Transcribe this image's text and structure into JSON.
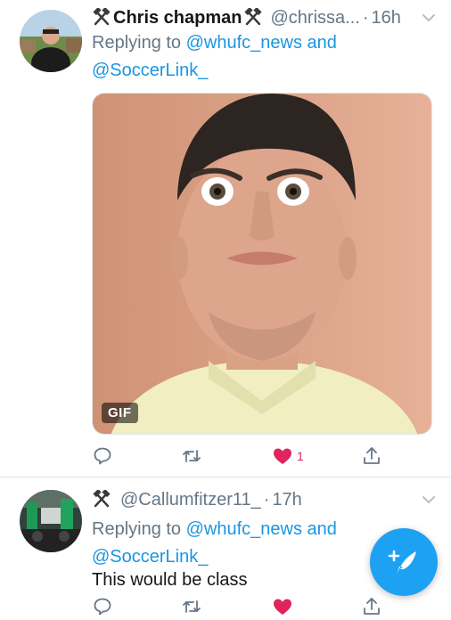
{
  "tweets": [
    {
      "name": "Chris chapman",
      "handle": "@chrissa...",
      "dot": "·",
      "time": "16h",
      "reply_prefix": "Replying to ",
      "reply_line1": "@whufc_news and",
      "reply_line2": "@SoccerLink_",
      "media_badge": "GIF",
      "like_count": "1"
    },
    {
      "handle": "@Callumfitzer11_",
      "dot": "·",
      "time": "17h",
      "reply_prefix": "Replying to ",
      "reply_line1": "@whufc_news and",
      "reply_line2": "@SoccerLink_",
      "text": "This would be class"
    }
  ],
  "colors": {
    "accent": "#1b95e0",
    "like": "#e0245e",
    "muted": "#657786",
    "fab": "#1da1f2"
  },
  "icons": [
    "hammers-icon",
    "chevron-down-icon",
    "reply-icon",
    "retweet-icon",
    "heart-icon",
    "share-icon",
    "compose-icon"
  ]
}
